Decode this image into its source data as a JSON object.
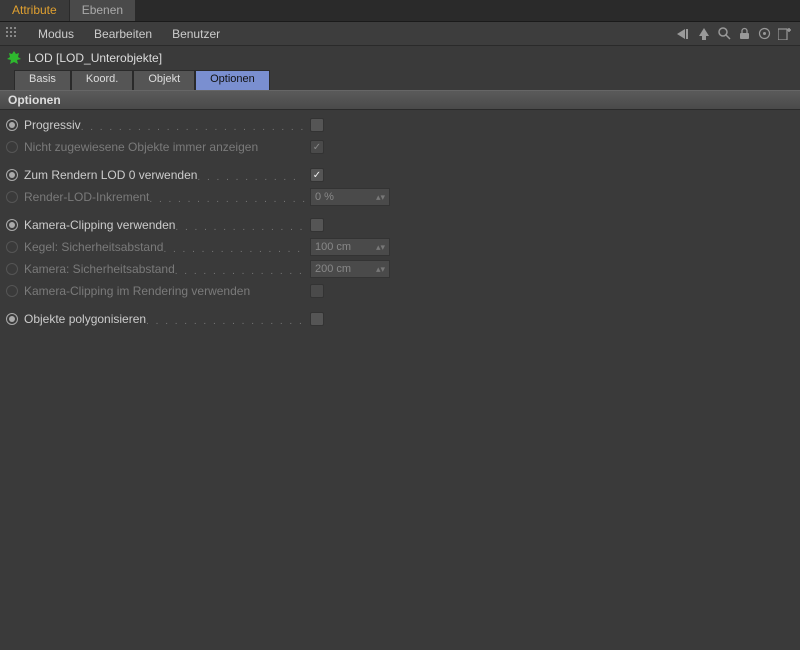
{
  "top_tabs": {
    "attribute": "Attribute",
    "ebenen": "Ebenen"
  },
  "menu": {
    "modus": "Modus",
    "bearbeiten": "Bearbeiten",
    "benutzer": "Benutzer"
  },
  "object": {
    "name": "LOD [LOD_Unterobjekte]"
  },
  "sub_tabs": {
    "basis": "Basis",
    "koord": "Koord.",
    "objekt": "Objekt",
    "optionen": "Optionen"
  },
  "section": {
    "title": "Optionen"
  },
  "rows": {
    "progressiv": "Progressiv",
    "nicht_zugewiesene": "Nicht zugewiesene Objekte immer anzeigen",
    "zum_rendern": "Zum Rendern LOD 0 verwenden",
    "render_lod_inkrement": "Render-LOD-Inkrement",
    "render_lod_inkrement_val": "0 %",
    "kamera_clipping": "Kamera-Clipping verwenden",
    "kegel": "Kegel: Sicherheitsabstand",
    "kegel_val": "100 cm",
    "kamera_abstand": "Kamera: Sicherheitsabstand",
    "kamera_abstand_val": "200 cm",
    "kamera_clipping_render": "Kamera-Clipping im Rendering verwenden",
    "polygonisieren": "Objekte polygonisieren"
  }
}
